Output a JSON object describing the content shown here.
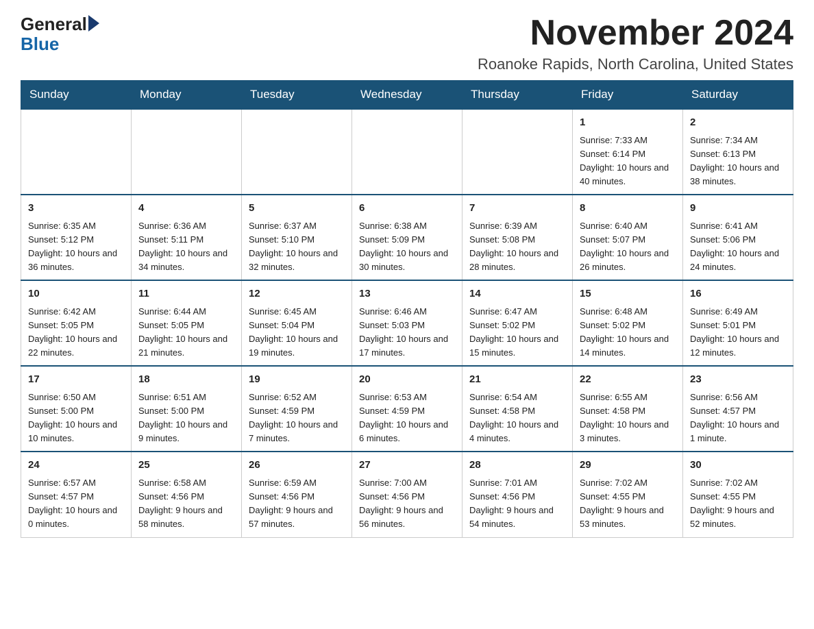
{
  "header": {
    "logo_general": "General",
    "logo_blue": "Blue",
    "month_title": "November 2024",
    "location": "Roanoke Rapids, North Carolina, United States"
  },
  "days_of_week": [
    "Sunday",
    "Monday",
    "Tuesday",
    "Wednesday",
    "Thursday",
    "Friday",
    "Saturday"
  ],
  "weeks": [
    {
      "days": [
        {
          "number": "",
          "info": ""
        },
        {
          "number": "",
          "info": ""
        },
        {
          "number": "",
          "info": ""
        },
        {
          "number": "",
          "info": ""
        },
        {
          "number": "",
          "info": ""
        },
        {
          "number": "1",
          "info": "Sunrise: 7:33 AM\nSunset: 6:14 PM\nDaylight: 10 hours\nand 40 minutes."
        },
        {
          "number": "2",
          "info": "Sunrise: 7:34 AM\nSunset: 6:13 PM\nDaylight: 10 hours\nand 38 minutes."
        }
      ]
    },
    {
      "days": [
        {
          "number": "3",
          "info": "Sunrise: 6:35 AM\nSunset: 5:12 PM\nDaylight: 10 hours\nand 36 minutes."
        },
        {
          "number": "4",
          "info": "Sunrise: 6:36 AM\nSunset: 5:11 PM\nDaylight: 10 hours\nand 34 minutes."
        },
        {
          "number": "5",
          "info": "Sunrise: 6:37 AM\nSunset: 5:10 PM\nDaylight: 10 hours\nand 32 minutes."
        },
        {
          "number": "6",
          "info": "Sunrise: 6:38 AM\nSunset: 5:09 PM\nDaylight: 10 hours\nand 30 minutes."
        },
        {
          "number": "7",
          "info": "Sunrise: 6:39 AM\nSunset: 5:08 PM\nDaylight: 10 hours\nand 28 minutes."
        },
        {
          "number": "8",
          "info": "Sunrise: 6:40 AM\nSunset: 5:07 PM\nDaylight: 10 hours\nand 26 minutes."
        },
        {
          "number": "9",
          "info": "Sunrise: 6:41 AM\nSunset: 5:06 PM\nDaylight: 10 hours\nand 24 minutes."
        }
      ]
    },
    {
      "days": [
        {
          "number": "10",
          "info": "Sunrise: 6:42 AM\nSunset: 5:05 PM\nDaylight: 10 hours\nand 22 minutes."
        },
        {
          "number": "11",
          "info": "Sunrise: 6:44 AM\nSunset: 5:05 PM\nDaylight: 10 hours\nand 21 minutes."
        },
        {
          "number": "12",
          "info": "Sunrise: 6:45 AM\nSunset: 5:04 PM\nDaylight: 10 hours\nand 19 minutes."
        },
        {
          "number": "13",
          "info": "Sunrise: 6:46 AM\nSunset: 5:03 PM\nDaylight: 10 hours\nand 17 minutes."
        },
        {
          "number": "14",
          "info": "Sunrise: 6:47 AM\nSunset: 5:02 PM\nDaylight: 10 hours\nand 15 minutes."
        },
        {
          "number": "15",
          "info": "Sunrise: 6:48 AM\nSunset: 5:02 PM\nDaylight: 10 hours\nand 14 minutes."
        },
        {
          "number": "16",
          "info": "Sunrise: 6:49 AM\nSunset: 5:01 PM\nDaylight: 10 hours\nand 12 minutes."
        }
      ]
    },
    {
      "days": [
        {
          "number": "17",
          "info": "Sunrise: 6:50 AM\nSunset: 5:00 PM\nDaylight: 10 hours\nand 10 minutes."
        },
        {
          "number": "18",
          "info": "Sunrise: 6:51 AM\nSunset: 5:00 PM\nDaylight: 10 hours\nand 9 minutes."
        },
        {
          "number": "19",
          "info": "Sunrise: 6:52 AM\nSunset: 4:59 PM\nDaylight: 10 hours\nand 7 minutes."
        },
        {
          "number": "20",
          "info": "Sunrise: 6:53 AM\nSunset: 4:59 PM\nDaylight: 10 hours\nand 6 minutes."
        },
        {
          "number": "21",
          "info": "Sunrise: 6:54 AM\nSunset: 4:58 PM\nDaylight: 10 hours\nand 4 minutes."
        },
        {
          "number": "22",
          "info": "Sunrise: 6:55 AM\nSunset: 4:58 PM\nDaylight: 10 hours\nand 3 minutes."
        },
        {
          "number": "23",
          "info": "Sunrise: 6:56 AM\nSunset: 4:57 PM\nDaylight: 10 hours\nand 1 minute."
        }
      ]
    },
    {
      "days": [
        {
          "number": "24",
          "info": "Sunrise: 6:57 AM\nSunset: 4:57 PM\nDaylight: 10 hours\nand 0 minutes."
        },
        {
          "number": "25",
          "info": "Sunrise: 6:58 AM\nSunset: 4:56 PM\nDaylight: 9 hours\nand 58 minutes."
        },
        {
          "number": "26",
          "info": "Sunrise: 6:59 AM\nSunset: 4:56 PM\nDaylight: 9 hours\nand 57 minutes."
        },
        {
          "number": "27",
          "info": "Sunrise: 7:00 AM\nSunset: 4:56 PM\nDaylight: 9 hours\nand 56 minutes."
        },
        {
          "number": "28",
          "info": "Sunrise: 7:01 AM\nSunset: 4:56 PM\nDaylight: 9 hours\nand 54 minutes."
        },
        {
          "number": "29",
          "info": "Sunrise: 7:02 AM\nSunset: 4:55 PM\nDaylight: 9 hours\nand 53 minutes."
        },
        {
          "number": "30",
          "info": "Sunrise: 7:02 AM\nSunset: 4:55 PM\nDaylight: 9 hours\nand 52 minutes."
        }
      ]
    }
  ]
}
